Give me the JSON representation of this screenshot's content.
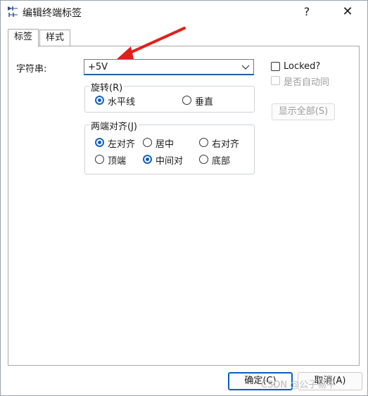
{
  "window": {
    "title": "编辑终端标签",
    "help": "?",
    "close": "✕"
  },
  "tabs": [
    {
      "label": "标签"
    },
    {
      "label": "样式"
    }
  ],
  "string_field": {
    "label": "字符串:",
    "value": "+5V"
  },
  "locked": {
    "label": "Locked?"
  },
  "auto_same": {
    "label": "是否自动同"
  },
  "rotation": {
    "title": "旋转(R)",
    "options": [
      {
        "label": "水平线",
        "selected": true
      },
      {
        "label": "垂直",
        "selected": false
      }
    ]
  },
  "show_all_button": {
    "label": "显示全部(S)"
  },
  "justify": {
    "title": "两端对齐(J)",
    "horizontal": [
      {
        "label": "左对齐",
        "selected": true
      },
      {
        "label": "居中",
        "selected": false
      },
      {
        "label": "右对齐",
        "selected": false
      }
    ],
    "vertical": [
      {
        "label": "顶端",
        "selected": false
      },
      {
        "label": "中间对",
        "selected": true
      },
      {
        "label": "底部",
        "selected": false
      }
    ]
  },
  "footer": {
    "ok": "确定(C)",
    "cancel": "取消(A)"
  },
  "watermark": "CSDN @公子易平",
  "colors": {
    "accent": "#0a5dc4",
    "arrow": "#e0201b"
  }
}
